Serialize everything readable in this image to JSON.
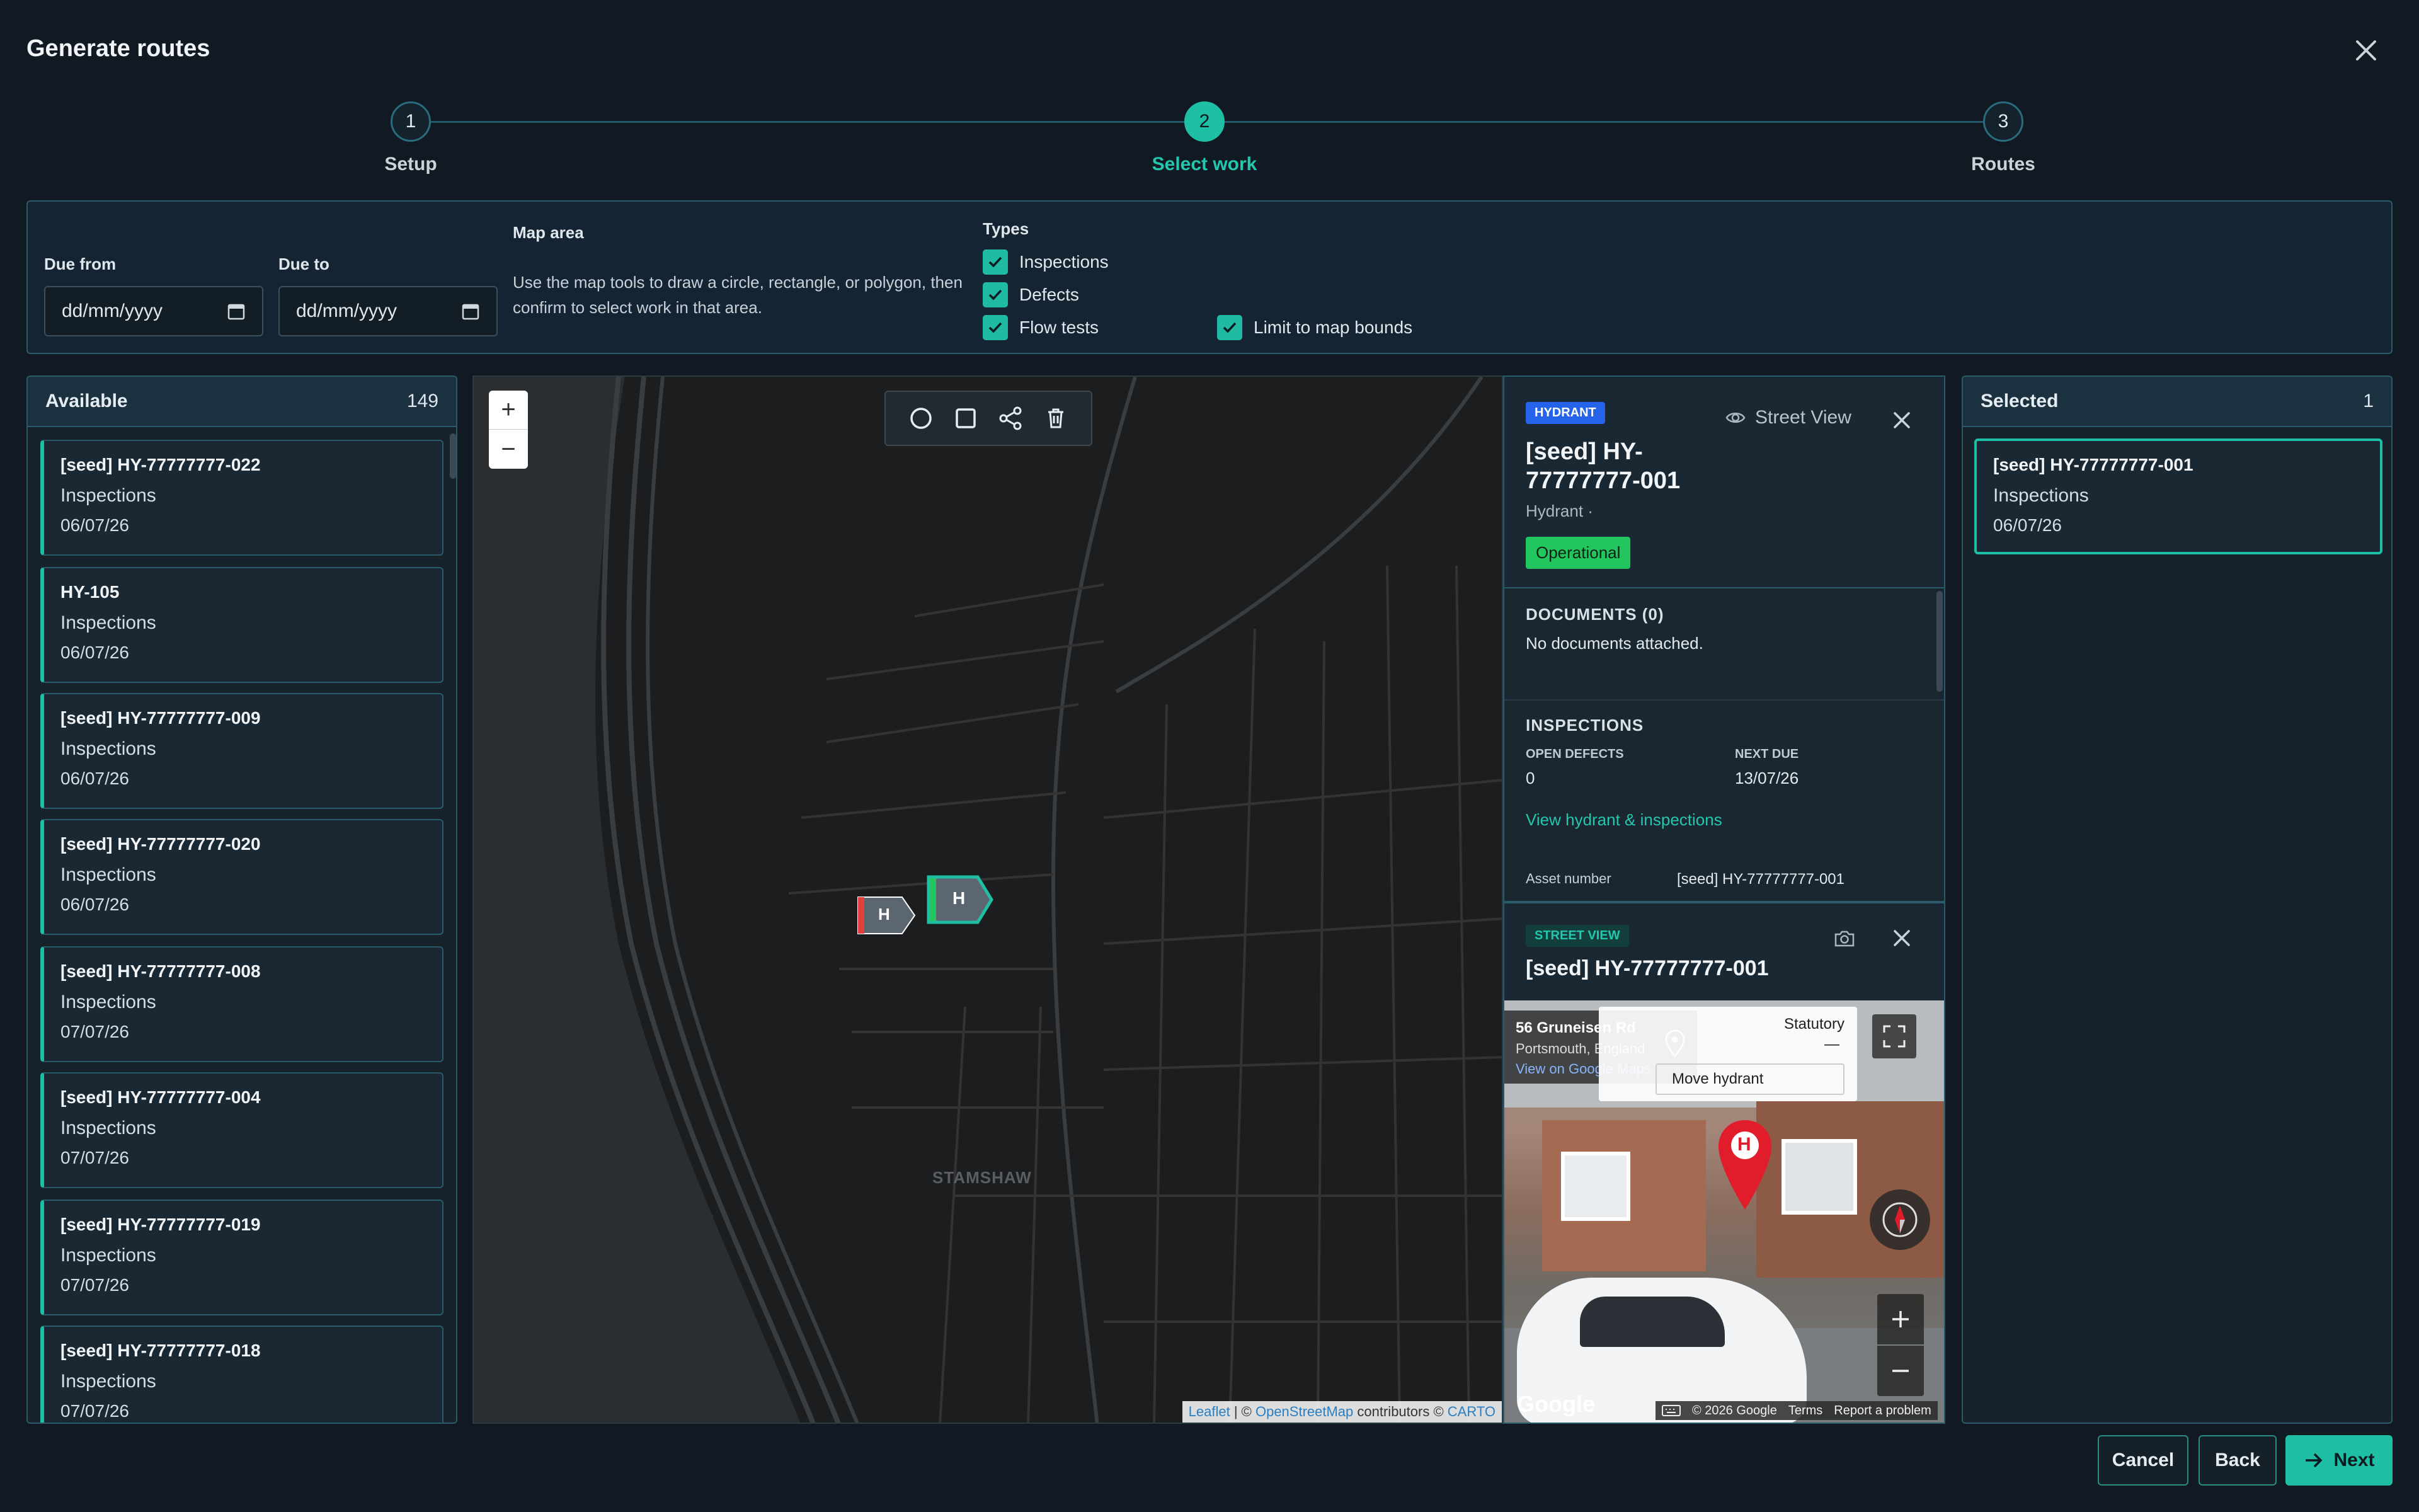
{
  "dialog": {
    "title": "Generate routes"
  },
  "steps": [
    {
      "number": "1",
      "label": "Setup"
    },
    {
      "number": "2",
      "label": "Select work"
    },
    {
      "number": "3",
      "label": "Routes"
    }
  ],
  "filters": {
    "due_from": {
      "label": "Due from",
      "placeholder": "dd/mm/yyyy"
    },
    "due_to": {
      "label": "Due to",
      "placeholder": "dd/mm/yyyy"
    },
    "map_area": {
      "label": "Map area",
      "description": "Use the map tools to draw a circle, rectangle, or polygon, then confirm to select work in that area."
    },
    "types": {
      "label": "Types",
      "options": [
        {
          "label": "Inspections",
          "checked": true
        },
        {
          "label": "Defects",
          "checked": true
        },
        {
          "label": "Flow tests",
          "checked": true
        }
      ]
    },
    "limit_to_map_bounds": {
      "label": "Limit to map bounds",
      "checked": true
    }
  },
  "available": {
    "title": "Available",
    "count": "149",
    "items": [
      {
        "title": "[seed] HY-77777777-022",
        "type": "Inspections",
        "date": "06/07/26"
      },
      {
        "title": "HY-105",
        "type": "Inspections",
        "date": "06/07/26"
      },
      {
        "title": "[seed] HY-77777777-009",
        "type": "Inspections",
        "date": "06/07/26"
      },
      {
        "title": "[seed] HY-77777777-020",
        "type": "Inspections",
        "date": "06/07/26"
      },
      {
        "title": "[seed] HY-77777777-008",
        "type": "Inspections",
        "date": "07/07/26"
      },
      {
        "title": "[seed] HY-77777777-004",
        "type": "Inspections",
        "date": "07/07/26"
      },
      {
        "title": "[seed] HY-77777777-019",
        "type": "Inspections",
        "date": "07/07/26"
      },
      {
        "title": "[seed] HY-77777777-018",
        "type": "Inspections",
        "date": "07/07/26"
      }
    ]
  },
  "map": {
    "zoom_in": "+",
    "zoom_out": "−",
    "area_label": "STAMSHAW",
    "marker_label": "H",
    "attribution": {
      "leaflet": "Leaflet",
      "sep1": " | © ",
      "osm": "OpenStreetMap",
      "contrib": " contributors © ",
      "carto": "CARTO"
    }
  },
  "hydrant_panel": {
    "badge": "HYDRANT",
    "street_view_label": "Street View",
    "title": "[seed] HY-77777777-001",
    "subtitle": "Hydrant ·",
    "status": "Operational",
    "documents_title": "DOCUMENTS (0)",
    "documents_empty": "No documents attached.",
    "inspections_title": "INSPECTIONS",
    "open_defects_label": "OPEN DEFECTS",
    "open_defects_value": "0",
    "next_due_label": "NEXT DUE",
    "next_due_value": "13/07/26",
    "view_link": "View hydrant & inspections",
    "asset_number_label": "Asset number",
    "asset_number_value": "[seed] HY-77777777-001"
  },
  "street_view_panel": {
    "badge": "STREET VIEW",
    "title": "[seed] HY-77777777-001",
    "address_line1": "56 Gruneisen Rd",
    "address_line2": "Portsmouth, England",
    "google_maps_link": "View on Google Maps",
    "statutory_label": "Statutory",
    "statutory_value": "—",
    "move_hydrant": "Move hydrant",
    "pin_label": "H",
    "google_logo": "Google",
    "footer_copyright": "© 2026 Google",
    "footer_terms": "Terms",
    "footer_report": "Report a problem"
  },
  "selected": {
    "title": "Selected",
    "count": "1",
    "items": [
      {
        "title": "[seed] HY-77777777-001",
        "type": "Inspections",
        "date": "06/07/26"
      }
    ]
  },
  "footer": {
    "cancel": "Cancel",
    "back": "Back",
    "next": "Next"
  },
  "colors": {
    "accent": "#1fbfa6",
    "badge_blue": "#2563eb",
    "status_green": "#22c55e"
  }
}
